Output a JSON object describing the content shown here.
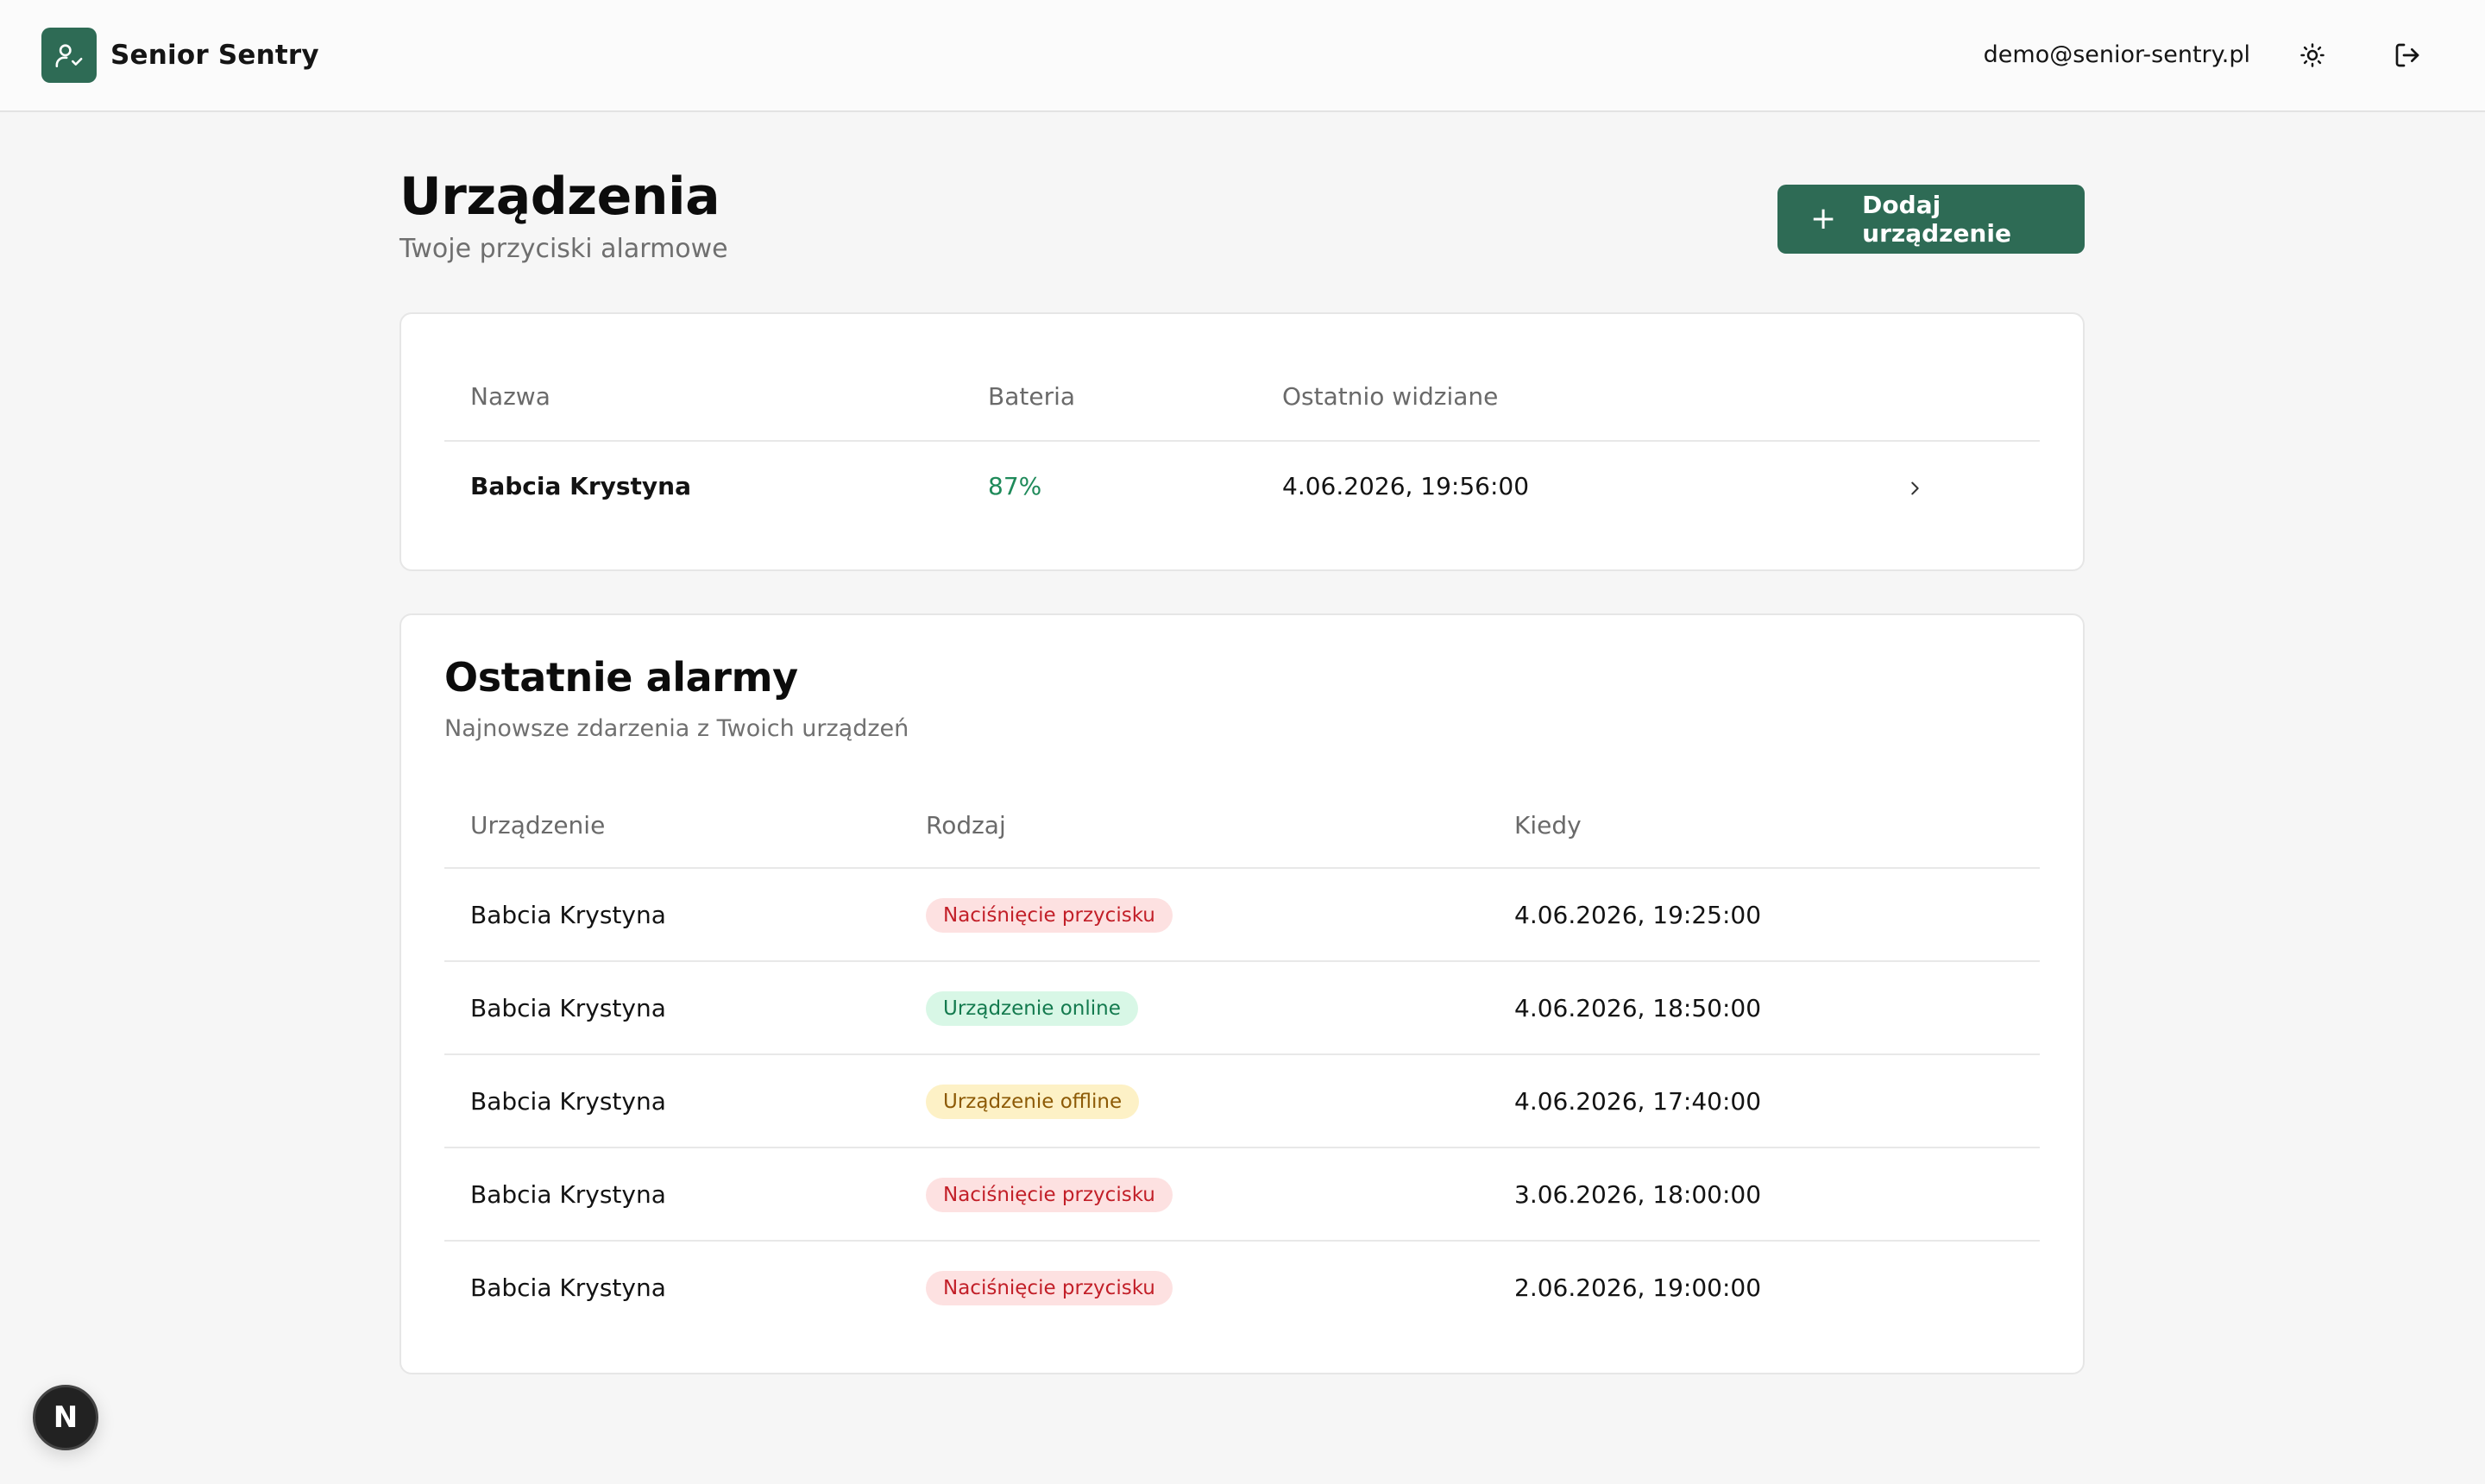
{
  "header": {
    "app_name": "Senior Sentry",
    "user_email": "demo@senior-sentry.pl",
    "icons": {
      "logo": "user-check-icon",
      "theme": "sun-icon",
      "logout": "logout-icon"
    }
  },
  "page": {
    "title": "Urządzenia",
    "subtitle": "Twoje przyciski alarmowe",
    "add_button_label": "Dodaj urządzenie"
  },
  "devices": {
    "columns": [
      "Nazwa",
      "Bateria",
      "Ostatnio widziane"
    ],
    "rows": [
      {
        "name": "Babcia Krystyna",
        "battery": "87%",
        "last_seen": "4.06.2026, 19:56:00"
      }
    ]
  },
  "alarms": {
    "title": "Ostatnie alarmy",
    "subtitle": "Najnowsze zdarzenia z Twoich urządzeń",
    "columns": [
      "Urządzenie",
      "Rodzaj",
      "Kiedy"
    ],
    "rows": [
      {
        "device": "Babcia Krystyna",
        "type": "Naciśnięcie przycisku",
        "type_color": "red",
        "when": "4.06.2026, 19:25:00"
      },
      {
        "device": "Babcia Krystyna",
        "type": "Urządzenie online",
        "type_color": "green",
        "when": "4.06.2026, 18:50:00"
      },
      {
        "device": "Babcia Krystyna",
        "type": "Urządzenie offline",
        "type_color": "yellow",
        "when": "4.06.2026, 17:40:00"
      },
      {
        "device": "Babcia Krystyna",
        "type": "Naciśnięcie przycisku",
        "type_color": "red",
        "when": "3.06.2026, 18:00:00"
      },
      {
        "device": "Babcia Krystyna",
        "type": "Naciśnięcie przycisku",
        "type_color": "red",
        "when": "2.06.2026, 19:00:00"
      }
    ]
  },
  "colors": {
    "brand": "#2e6b55",
    "battery_ok": "#1f8a5a"
  },
  "dev_indicator": {
    "letter": "N"
  }
}
